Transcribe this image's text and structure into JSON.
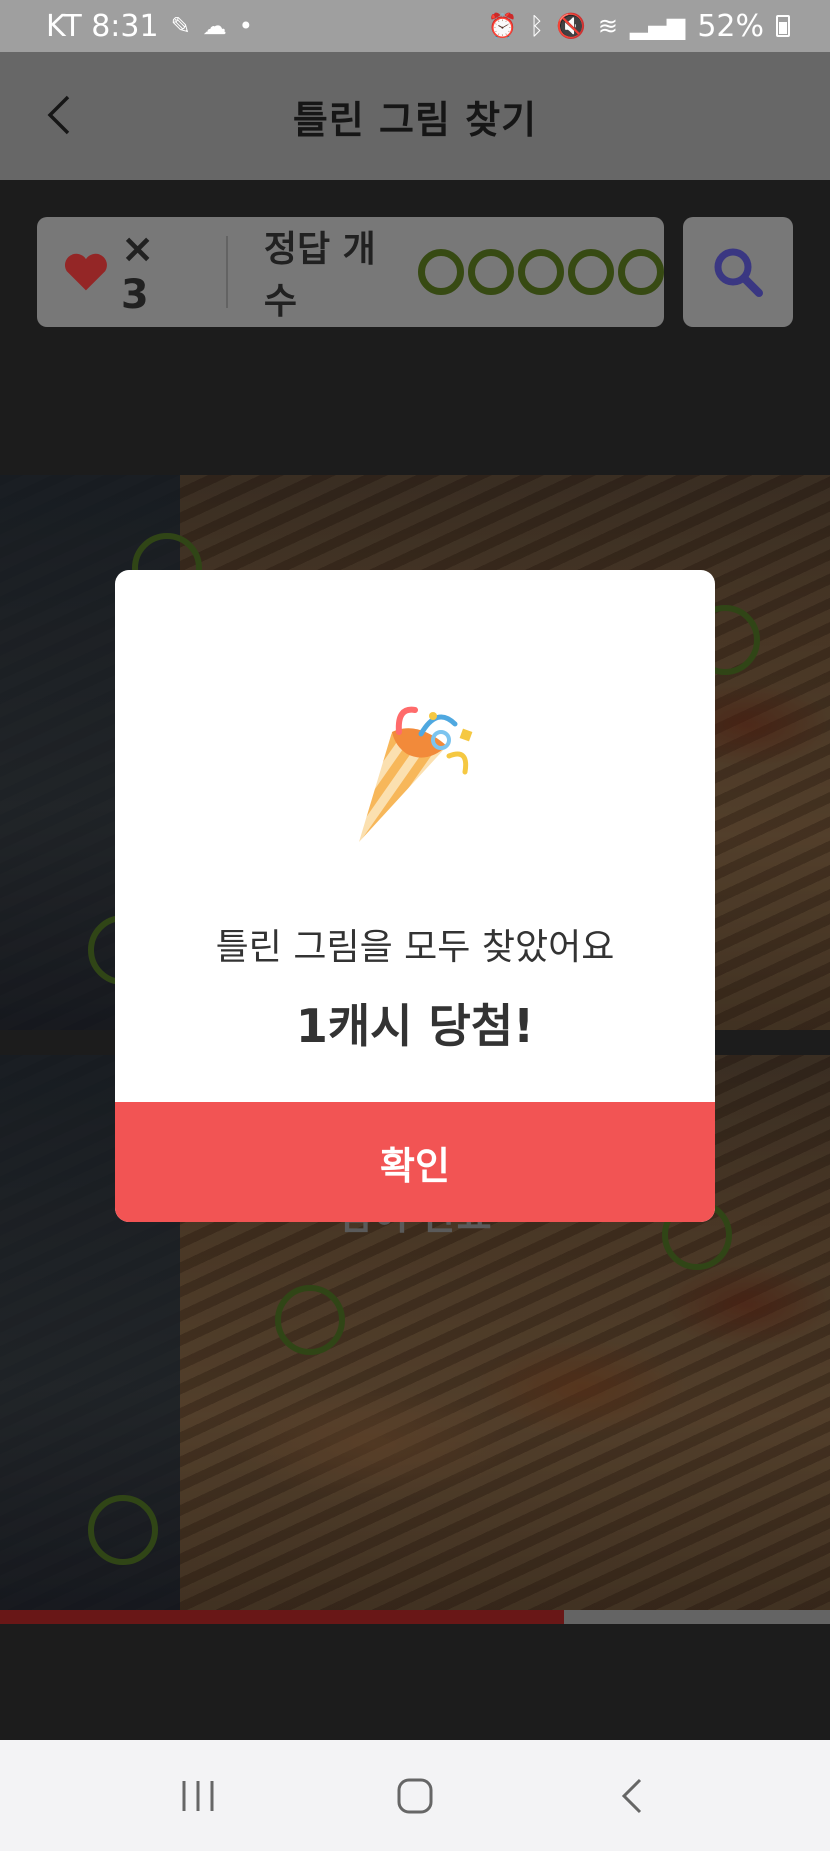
{
  "status_bar": {
    "carrier_time": "KT 8:31",
    "battery": "52%"
  },
  "app_bar": {
    "title": "틀린 그림 찾기",
    "back_icon": "chevron-left-icon"
  },
  "game": {
    "lives_count": "× 3",
    "answer_label": "정답 개수",
    "answers_found": 5,
    "answers_total": 5,
    "done_label": "참여 완료",
    "progress_fraction": 0.68,
    "colors": {
      "ring": "#55721e",
      "progress": "#a12424",
      "heart": "#e33b3b",
      "search": "#5a55c8"
    }
  },
  "modal": {
    "icon": "party-popper-icon",
    "message": "틀린 그림을 모두 찾았어요",
    "prize": "1캐시 당첨!",
    "confirm_label": "확인",
    "button_color": "#f25454"
  },
  "nav_bar": {
    "recent_icon": "recent-apps-icon",
    "home_icon": "home-icon",
    "back_icon": "back-icon"
  }
}
